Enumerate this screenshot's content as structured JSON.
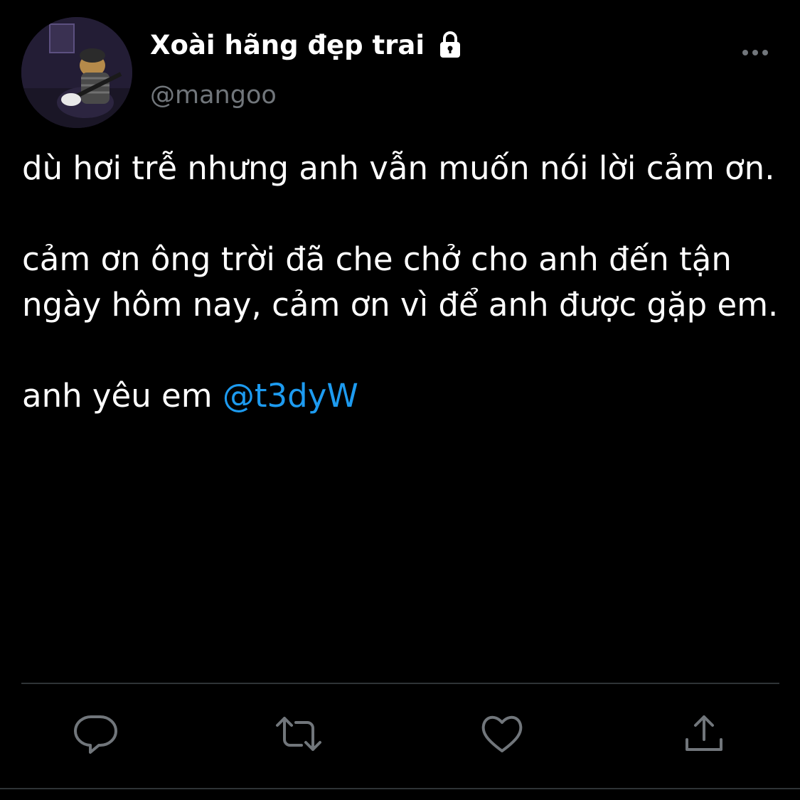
{
  "header": {
    "display_name": "Xoài hãng đẹp trai",
    "handle": "@mangoo",
    "protected_icon": "lock-icon",
    "more_icon": "more-horizontal-icon"
  },
  "tweet": {
    "paragraphs": [
      "dù hơi trễ nhưng anh vẫn muốn nói lời cảm ơn.",
      "cảm ơn ông trời đã che chở cho anh đến tận ngày hôm nay, cảm ơn vì để anh được gặp em."
    ],
    "last_line_text": "anh yêu em ",
    "mention": "@t3dyW"
  },
  "actions": {
    "reply_icon": "reply-icon",
    "retweet_icon": "retweet-icon",
    "like_icon": "heart-icon",
    "share_icon": "share-icon"
  },
  "colors": {
    "background": "#000000",
    "text": "#ffffff",
    "secondary_text": "#71767b",
    "mention": "#1d9bf0",
    "divider": "#2f3336"
  }
}
